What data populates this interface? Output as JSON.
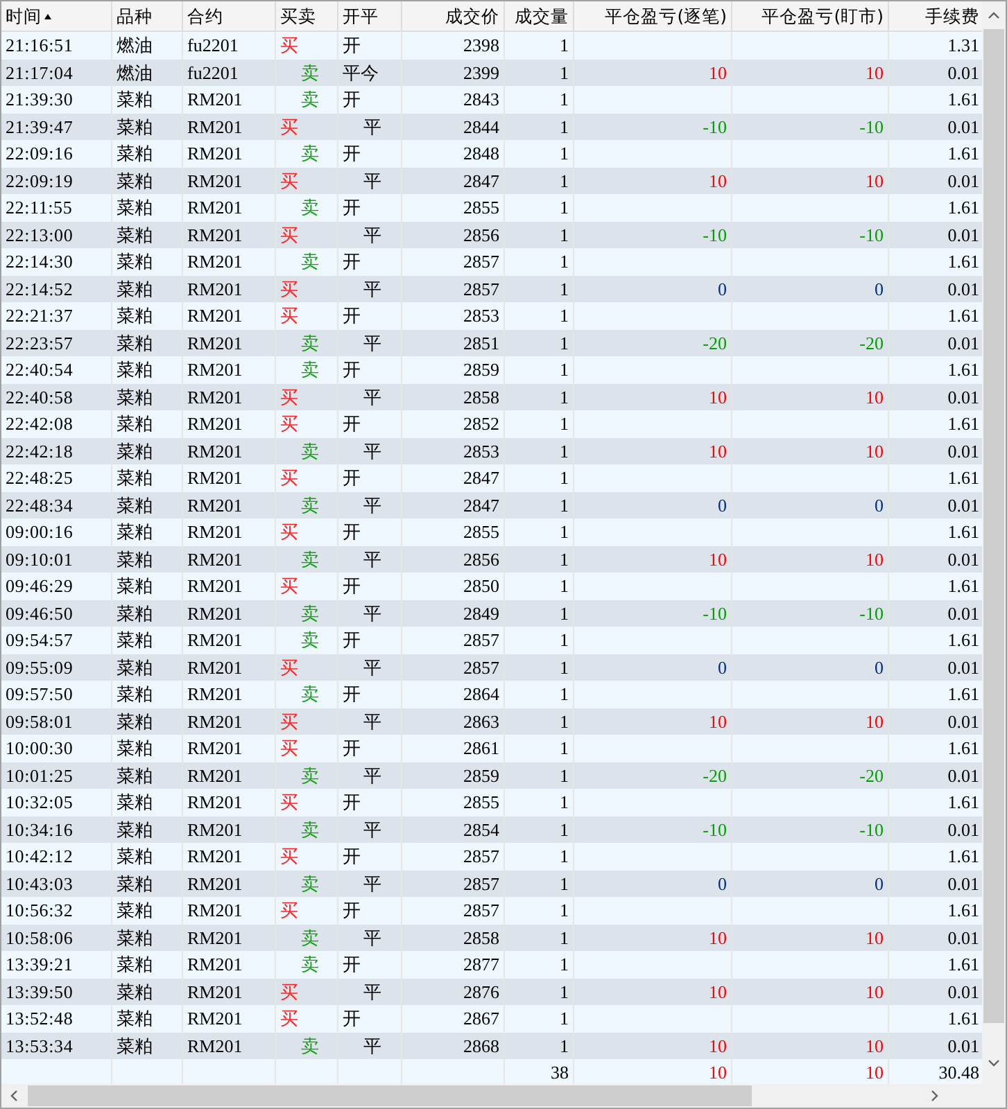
{
  "columns": [
    {
      "label": "时间",
      "sorted": true
    },
    {
      "label": "品种",
      "sorted": false
    },
    {
      "label": "合约",
      "sorted": false
    },
    {
      "label": "买卖",
      "sorted": false
    },
    {
      "label": "开平",
      "sorted": false
    },
    {
      "label": "成交价",
      "sorted": false
    },
    {
      "label": "成交量",
      "sorted": false
    },
    {
      "label": "平仓盈亏(逐笔)",
      "sorted": false
    },
    {
      "label": "平仓盈亏(盯市)",
      "sorted": false
    },
    {
      "label": "手续费",
      "sorted": false
    }
  ],
  "rows": [
    {
      "time": "21:16:51",
      "product": "燃油",
      "contract": "fu2201",
      "side": {
        "text": "买",
        "kind": "buy"
      },
      "offset": {
        "text": "开",
        "kind": "open"
      },
      "price": "2398",
      "qty": "1",
      "fee": "1.31"
    },
    {
      "time": "21:17:04",
      "product": "燃油",
      "contract": "fu2201",
      "side": {
        "text": "卖",
        "kind": "sell"
      },
      "offset": {
        "text": "平今",
        "kind": "open"
      },
      "price": "2399",
      "qty": "1",
      "pnl_trade": {
        "text": "10",
        "color": "#ff0000"
      },
      "pnl_mark": {
        "text": "10",
        "color": "#ff0000"
      },
      "fee": "0.01"
    },
    {
      "time": "21:39:30",
      "product": "菜粕",
      "contract": "RM201",
      "side": {
        "text": "卖",
        "kind": "sell"
      },
      "offset": {
        "text": "开",
        "kind": "open"
      },
      "price": "2843",
      "qty": "1",
      "fee": "1.61"
    },
    {
      "time": "21:39:47",
      "product": "菜粕",
      "contract": "RM201",
      "side": {
        "text": "买",
        "kind": "buy"
      },
      "offset": {
        "text": "平",
        "kind": "close"
      },
      "price": "2844",
      "qty": "1",
      "pnl_trade": {
        "text": "-10",
        "color": "#00a000"
      },
      "pnl_mark": {
        "text": "-10",
        "color": "#00a000"
      },
      "fee": "0.01"
    },
    {
      "time": "22:09:16",
      "product": "菜粕",
      "contract": "RM201",
      "side": {
        "text": "卖",
        "kind": "sell"
      },
      "offset": {
        "text": "开",
        "kind": "open"
      },
      "price": "2848",
      "qty": "1",
      "fee": "1.61"
    },
    {
      "time": "22:09:19",
      "product": "菜粕",
      "contract": "RM201",
      "side": {
        "text": "买",
        "kind": "buy"
      },
      "offset": {
        "text": "平",
        "kind": "close"
      },
      "price": "2847",
      "qty": "1",
      "pnl_trade": {
        "text": "10",
        "color": "#ff0000"
      },
      "pnl_mark": {
        "text": "10",
        "color": "#ff0000"
      },
      "fee": "0.01"
    },
    {
      "time": "22:11:55",
      "product": "菜粕",
      "contract": "RM201",
      "side": {
        "text": "卖",
        "kind": "sell"
      },
      "offset": {
        "text": "开",
        "kind": "open"
      },
      "price": "2855",
      "qty": "1",
      "fee": "1.61"
    },
    {
      "time": "22:13:00",
      "product": "菜粕",
      "contract": "RM201",
      "side": {
        "text": "买",
        "kind": "buy"
      },
      "offset": {
        "text": "平",
        "kind": "close"
      },
      "price": "2856",
      "qty": "1",
      "pnl_trade": {
        "text": "-10",
        "color": "#00a000"
      },
      "pnl_mark": {
        "text": "-10",
        "color": "#00a000"
      },
      "fee": "0.01"
    },
    {
      "time": "22:14:30",
      "product": "菜粕",
      "contract": "RM201",
      "side": {
        "text": "卖",
        "kind": "sell"
      },
      "offset": {
        "text": "开",
        "kind": "open"
      },
      "price": "2857",
      "qty": "1",
      "fee": "1.61"
    },
    {
      "time": "22:14:52",
      "product": "菜粕",
      "contract": "RM201",
      "side": {
        "text": "买",
        "kind": "buy"
      },
      "offset": {
        "text": "平",
        "kind": "close"
      },
      "price": "2857",
      "qty": "1",
      "pnl_trade": {
        "text": "0",
        "color": "#003080"
      },
      "pnl_mark": {
        "text": "0",
        "color": "#003080"
      },
      "fee": "0.01"
    },
    {
      "time": "22:21:37",
      "product": "菜粕",
      "contract": "RM201",
      "side": {
        "text": "买",
        "kind": "buy"
      },
      "offset": {
        "text": "开",
        "kind": "open"
      },
      "price": "2853",
      "qty": "1",
      "fee": "1.61"
    },
    {
      "time": "22:23:57",
      "product": "菜粕",
      "contract": "RM201",
      "side": {
        "text": "卖",
        "kind": "sell"
      },
      "offset": {
        "text": "平",
        "kind": "close"
      },
      "price": "2851",
      "qty": "1",
      "pnl_trade": {
        "text": "-20",
        "color": "#00a000"
      },
      "pnl_mark": {
        "text": "-20",
        "color": "#00a000"
      },
      "fee": "0.01"
    },
    {
      "time": "22:40:54",
      "product": "菜粕",
      "contract": "RM201",
      "side": {
        "text": "卖",
        "kind": "sell"
      },
      "offset": {
        "text": "开",
        "kind": "open"
      },
      "price": "2859",
      "qty": "1",
      "fee": "1.61"
    },
    {
      "time": "22:40:58",
      "product": "菜粕",
      "contract": "RM201",
      "side": {
        "text": "买",
        "kind": "buy"
      },
      "offset": {
        "text": "平",
        "kind": "close"
      },
      "price": "2858",
      "qty": "1",
      "pnl_trade": {
        "text": "10",
        "color": "#ff0000"
      },
      "pnl_mark": {
        "text": "10",
        "color": "#ff0000"
      },
      "fee": "0.01"
    },
    {
      "time": "22:42:08",
      "product": "菜粕",
      "contract": "RM201",
      "side": {
        "text": "买",
        "kind": "buy"
      },
      "offset": {
        "text": "开",
        "kind": "open"
      },
      "price": "2852",
      "qty": "1",
      "fee": "1.61"
    },
    {
      "time": "22:42:18",
      "product": "菜粕",
      "contract": "RM201",
      "side": {
        "text": "卖",
        "kind": "sell"
      },
      "offset": {
        "text": "平",
        "kind": "close"
      },
      "price": "2853",
      "qty": "1",
      "pnl_trade": {
        "text": "10",
        "color": "#ff0000"
      },
      "pnl_mark": {
        "text": "10",
        "color": "#ff0000"
      },
      "fee": "0.01"
    },
    {
      "time": "22:48:25",
      "product": "菜粕",
      "contract": "RM201",
      "side": {
        "text": "买",
        "kind": "buy"
      },
      "offset": {
        "text": "开",
        "kind": "open"
      },
      "price": "2847",
      "qty": "1",
      "fee": "1.61"
    },
    {
      "time": "22:48:34",
      "product": "菜粕",
      "contract": "RM201",
      "side": {
        "text": "卖",
        "kind": "sell"
      },
      "offset": {
        "text": "平",
        "kind": "close"
      },
      "price": "2847",
      "qty": "1",
      "pnl_trade": {
        "text": "0",
        "color": "#003080"
      },
      "pnl_mark": {
        "text": "0",
        "color": "#003080"
      },
      "fee": "0.01"
    },
    {
      "time": "09:00:16",
      "product": "菜粕",
      "contract": "RM201",
      "side": {
        "text": "买",
        "kind": "buy"
      },
      "offset": {
        "text": "开",
        "kind": "open"
      },
      "price": "2855",
      "qty": "1",
      "fee": "1.61"
    },
    {
      "time": "09:10:01",
      "product": "菜粕",
      "contract": "RM201",
      "side": {
        "text": "卖",
        "kind": "sell"
      },
      "offset": {
        "text": "平",
        "kind": "close"
      },
      "price": "2856",
      "qty": "1",
      "pnl_trade": {
        "text": "10",
        "color": "#ff0000"
      },
      "pnl_mark": {
        "text": "10",
        "color": "#ff0000"
      },
      "fee": "0.01"
    },
    {
      "time": "09:46:29",
      "product": "菜粕",
      "contract": "RM201",
      "side": {
        "text": "买",
        "kind": "buy"
      },
      "offset": {
        "text": "开",
        "kind": "open"
      },
      "price": "2850",
      "qty": "1",
      "fee": "1.61"
    },
    {
      "time": "09:46:50",
      "product": "菜粕",
      "contract": "RM201",
      "side": {
        "text": "卖",
        "kind": "sell"
      },
      "offset": {
        "text": "平",
        "kind": "close"
      },
      "price": "2849",
      "qty": "1",
      "pnl_trade": {
        "text": "-10",
        "color": "#00a000"
      },
      "pnl_mark": {
        "text": "-10",
        "color": "#00a000"
      },
      "fee": "0.01"
    },
    {
      "time": "09:54:57",
      "product": "菜粕",
      "contract": "RM201",
      "side": {
        "text": "卖",
        "kind": "sell"
      },
      "offset": {
        "text": "开",
        "kind": "open"
      },
      "price": "2857",
      "qty": "1",
      "fee": "1.61"
    },
    {
      "time": "09:55:09",
      "product": "菜粕",
      "contract": "RM201",
      "side": {
        "text": "买",
        "kind": "buy"
      },
      "offset": {
        "text": "平",
        "kind": "close"
      },
      "price": "2857",
      "qty": "1",
      "pnl_trade": {
        "text": "0",
        "color": "#003080"
      },
      "pnl_mark": {
        "text": "0",
        "color": "#003080"
      },
      "fee": "0.01"
    },
    {
      "time": "09:57:50",
      "product": "菜粕",
      "contract": "RM201",
      "side": {
        "text": "卖",
        "kind": "sell"
      },
      "offset": {
        "text": "开",
        "kind": "open"
      },
      "price": "2864",
      "qty": "1",
      "fee": "1.61"
    },
    {
      "time": "09:58:01",
      "product": "菜粕",
      "contract": "RM201",
      "side": {
        "text": "买",
        "kind": "buy"
      },
      "offset": {
        "text": "平",
        "kind": "close"
      },
      "price": "2863",
      "qty": "1",
      "pnl_trade": {
        "text": "10",
        "color": "#ff0000"
      },
      "pnl_mark": {
        "text": "10",
        "color": "#ff0000"
      },
      "fee": "0.01"
    },
    {
      "time": "10:00:30",
      "product": "菜粕",
      "contract": "RM201",
      "side": {
        "text": "买",
        "kind": "buy"
      },
      "offset": {
        "text": "开",
        "kind": "open"
      },
      "price": "2861",
      "qty": "1",
      "fee": "1.61"
    },
    {
      "time": "10:01:25",
      "product": "菜粕",
      "contract": "RM201",
      "side": {
        "text": "卖",
        "kind": "sell"
      },
      "offset": {
        "text": "平",
        "kind": "close"
      },
      "price": "2859",
      "qty": "1",
      "pnl_trade": {
        "text": "-20",
        "color": "#00a000"
      },
      "pnl_mark": {
        "text": "-20",
        "color": "#00a000"
      },
      "fee": "0.01"
    },
    {
      "time": "10:32:05",
      "product": "菜粕",
      "contract": "RM201",
      "side": {
        "text": "买",
        "kind": "buy"
      },
      "offset": {
        "text": "开",
        "kind": "open"
      },
      "price": "2855",
      "qty": "1",
      "fee": "1.61"
    },
    {
      "time": "10:34:16",
      "product": "菜粕",
      "contract": "RM201",
      "side": {
        "text": "卖",
        "kind": "sell"
      },
      "offset": {
        "text": "平",
        "kind": "close"
      },
      "price": "2854",
      "qty": "1",
      "pnl_trade": {
        "text": "-10",
        "color": "#00a000"
      },
      "pnl_mark": {
        "text": "-10",
        "color": "#00a000"
      },
      "fee": "0.01"
    },
    {
      "time": "10:42:12",
      "product": "菜粕",
      "contract": "RM201",
      "side": {
        "text": "买",
        "kind": "buy"
      },
      "offset": {
        "text": "开",
        "kind": "open"
      },
      "price": "2857",
      "qty": "1",
      "fee": "1.61"
    },
    {
      "time": "10:43:03",
      "product": "菜粕",
      "contract": "RM201",
      "side": {
        "text": "卖",
        "kind": "sell"
      },
      "offset": {
        "text": "平",
        "kind": "close"
      },
      "price": "2857",
      "qty": "1",
      "pnl_trade": {
        "text": "0",
        "color": "#003080"
      },
      "pnl_mark": {
        "text": "0",
        "color": "#003080"
      },
      "fee": "0.01"
    },
    {
      "time": "10:56:32",
      "product": "菜粕",
      "contract": "RM201",
      "side": {
        "text": "买",
        "kind": "buy"
      },
      "offset": {
        "text": "开",
        "kind": "open"
      },
      "price": "2857",
      "qty": "1",
      "fee": "1.61"
    },
    {
      "time": "10:58:06",
      "product": "菜粕",
      "contract": "RM201",
      "side": {
        "text": "卖",
        "kind": "sell"
      },
      "offset": {
        "text": "平",
        "kind": "close"
      },
      "price": "2858",
      "qty": "1",
      "pnl_trade": {
        "text": "10",
        "color": "#ff0000"
      },
      "pnl_mark": {
        "text": "10",
        "color": "#ff0000"
      },
      "fee": "0.01"
    },
    {
      "time": "13:39:21",
      "product": "菜粕",
      "contract": "RM201",
      "side": {
        "text": "卖",
        "kind": "sell"
      },
      "offset": {
        "text": "开",
        "kind": "open"
      },
      "price": "2877",
      "qty": "1",
      "fee": "1.61"
    },
    {
      "time": "13:39:50",
      "product": "菜粕",
      "contract": "RM201",
      "side": {
        "text": "买",
        "kind": "buy"
      },
      "offset": {
        "text": "平",
        "kind": "close"
      },
      "price": "2876",
      "qty": "1",
      "pnl_trade": {
        "text": "10",
        "color": "#ff0000"
      },
      "pnl_mark": {
        "text": "10",
        "color": "#ff0000"
      },
      "fee": "0.01"
    },
    {
      "time": "13:52:48",
      "product": "菜粕",
      "contract": "RM201",
      "side": {
        "text": "买",
        "kind": "buy"
      },
      "offset": {
        "text": "开",
        "kind": "open"
      },
      "price": "2867",
      "qty": "1",
      "fee": "1.61"
    },
    {
      "time": "13:53:34",
      "product": "菜粕",
      "contract": "RM201",
      "side": {
        "text": "卖",
        "kind": "sell"
      },
      "offset": {
        "text": "平",
        "kind": "close"
      },
      "price": "2868",
      "qty": "1",
      "pnl_trade": {
        "text": "10",
        "color": "#ff0000"
      },
      "pnl_mark": {
        "text": "10",
        "color": "#ff0000"
      },
      "fee": "0.01"
    }
  ],
  "totals": {
    "qty": "38",
    "pnl_trade": {
      "text": "10",
      "color": "#ff0000"
    },
    "pnl_mark": {
      "text": "10",
      "color": "#ff0000"
    },
    "fee": "30.48"
  }
}
